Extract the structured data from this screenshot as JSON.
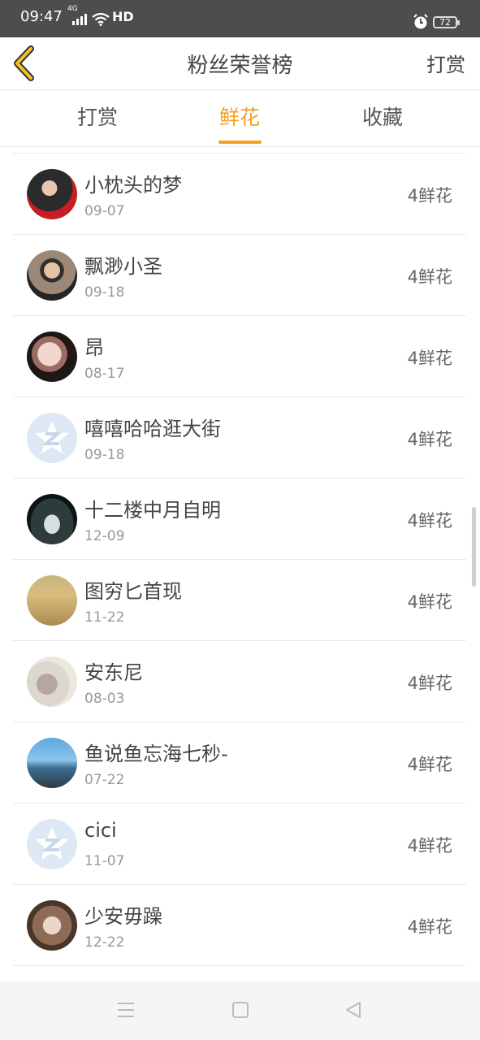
{
  "status_bar": {
    "time": "09:47",
    "network": "4G",
    "hd": "HD",
    "battery": "72"
  },
  "header": {
    "title": "粉丝荣誉榜",
    "right_action": "打赏"
  },
  "tabs": [
    {
      "label": "打赏",
      "active": false
    },
    {
      "label": "鲜花",
      "active": true
    },
    {
      "label": "收藏",
      "active": false
    }
  ],
  "list": [
    {
      "name": "小枕头的梦",
      "date": "09-07",
      "amount": "4鲜花",
      "avatar": "photo-avatar"
    },
    {
      "name": "飘渺小圣",
      "date": "09-18",
      "amount": "4鲜花",
      "avatar": "photo-avatar"
    },
    {
      "name": "昂",
      "date": "08-17",
      "amount": "4鲜花",
      "avatar": "photo-avatar"
    },
    {
      "name": "嘻嘻哈哈逛大街",
      "date": "09-18",
      "amount": "4鲜花",
      "avatar": "default-avatar"
    },
    {
      "name": "十二楼中月自明",
      "date": "12-09",
      "amount": "4鲜花",
      "avatar": "photo-avatar"
    },
    {
      "name": "图穷匕首现",
      "date": "11-22",
      "amount": "4鲜花",
      "avatar": "photo-avatar"
    },
    {
      "name": "安东尼",
      "date": "08-03",
      "amount": "4鲜花",
      "avatar": "photo-avatar"
    },
    {
      "name": "鱼说鱼忘海七秒-",
      "date": "07-22",
      "amount": "4鲜花",
      "avatar": "photo-avatar"
    },
    {
      "name": "cici",
      "date": "11-07",
      "amount": "4鲜花",
      "avatar": "default-avatar"
    },
    {
      "name": "少安毋躁",
      "date": "12-22",
      "amount": "4鲜花",
      "avatar": "photo-avatar"
    }
  ],
  "colors": {
    "accent": "#f2a11d",
    "status_bar": "#4d4d4d",
    "divider": "#e8e8e8"
  },
  "nav_icons": [
    "menu-icon",
    "home-square-icon",
    "back-triangle-icon"
  ]
}
